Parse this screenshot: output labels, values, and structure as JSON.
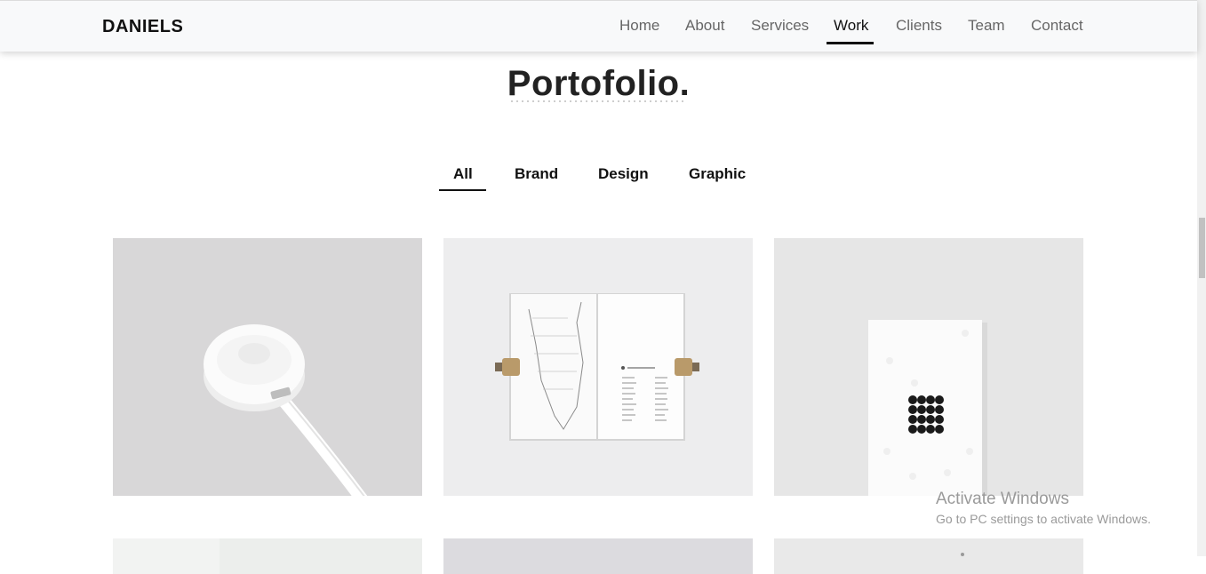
{
  "brand": "DANIELS",
  "nav": {
    "items": [
      "Home",
      "About",
      "Services",
      "Work",
      "Clients",
      "Team",
      "Contact"
    ],
    "active": "Work"
  },
  "portfolio": {
    "title": "Portofolio.",
    "filters": [
      "All",
      "Brand",
      "Design",
      "Graphic"
    ],
    "active_filter": "All",
    "tiles": [
      {
        "image": "apple-watch-charger-image"
      },
      {
        "image": "open-map-book-image"
      },
      {
        "image": "white-card-dots-image"
      },
      {
        "image": "portfolio-image-4"
      },
      {
        "image": "portfolio-image-5"
      },
      {
        "image": "portfolio-image-6"
      }
    ]
  },
  "watermark": {
    "title": "Activate Windows",
    "subtitle": "Go to PC settings to activate Windows."
  },
  "colors": {
    "header_bg": "#f8f9fa",
    "accent": "#111111",
    "nav_text": "#666666"
  }
}
